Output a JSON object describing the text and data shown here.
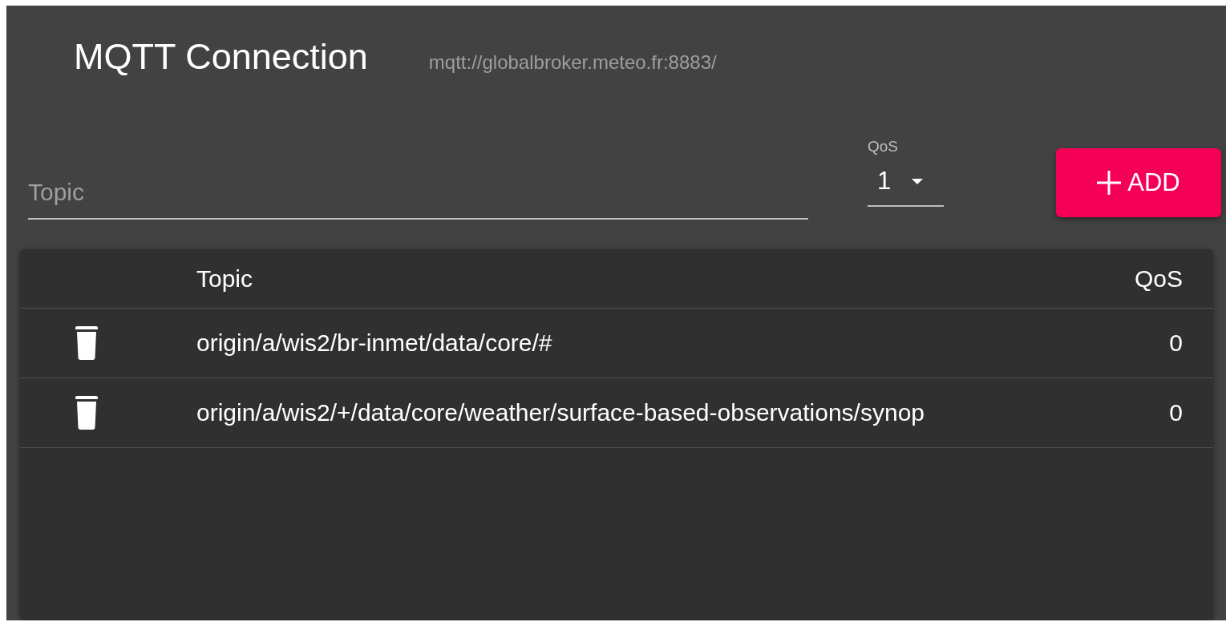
{
  "header": {
    "title": "MQTT Connection",
    "url": "mqtt://globalbroker.meteo.fr:8883/"
  },
  "form": {
    "topic_placeholder": "Topic",
    "qos_label": "QoS",
    "qos_value": "1",
    "add_button": "ADD"
  },
  "table": {
    "columns": [
      {
        "kind": "action"
      },
      {
        "kind": "topic",
        "label": "Topic"
      },
      {
        "kind": "qos",
        "label": "QoS"
      }
    ],
    "rows": [
      {
        "topic": "origin/a/wis2/br-inmet/data/core/#",
        "qos": "0"
      },
      {
        "topic": "origin/a/wis2/+/data/core/weather/surface-based-observations/synop",
        "qos": "0"
      }
    ]
  }
}
